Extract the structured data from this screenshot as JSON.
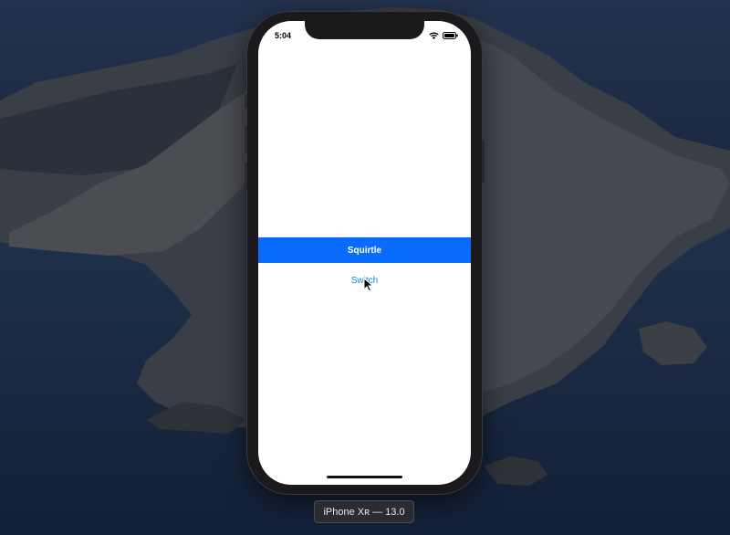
{
  "status_bar": {
    "time": "5:04",
    "icons": [
      "wifi-icon",
      "battery-icon"
    ]
  },
  "app": {
    "banner_label": "Squirtle",
    "switch_button_label": "Switch"
  },
  "simulator": {
    "device_label": "iPhone Xʀ — 13.0"
  },
  "colors": {
    "banner": "#0a6cff",
    "link": "#1580e6",
    "screen_background": "#ffffff"
  }
}
